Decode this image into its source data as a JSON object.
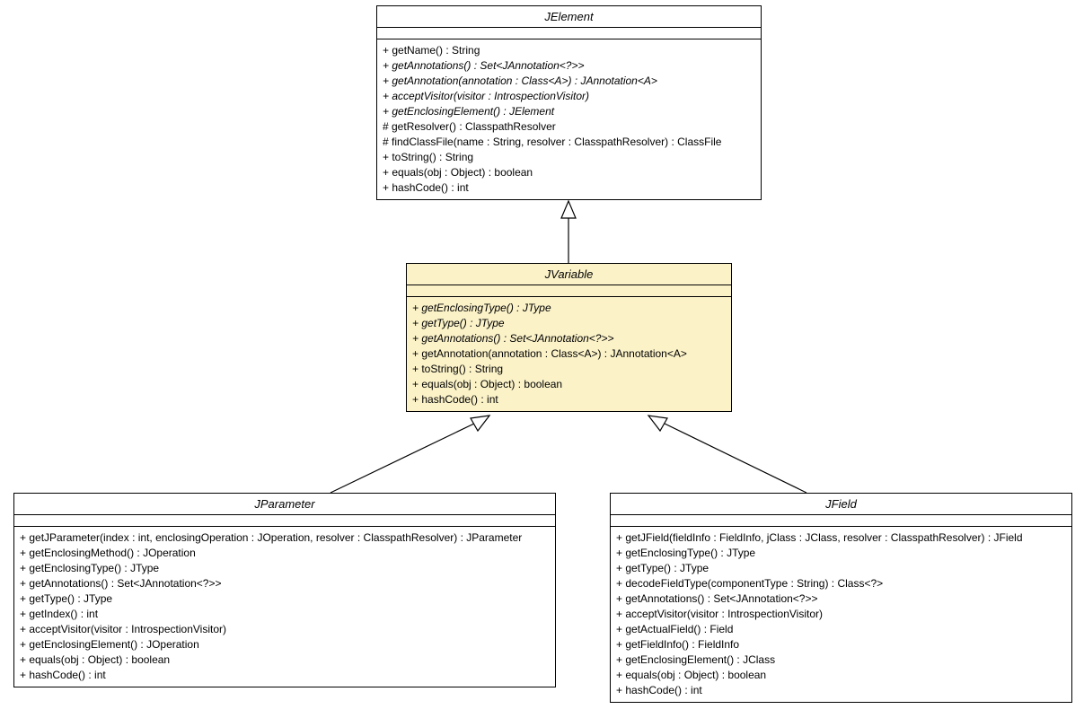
{
  "classes": {
    "jelement": {
      "name": "JElement",
      "methods": [
        {
          "text": "+ getName() : String",
          "italic": false
        },
        {
          "text": "+ getAnnotations() : Set<JAnnotation<?>>",
          "italic": true
        },
        {
          "text": "+ getAnnotation(annotation : Class<A>) : JAnnotation<A>",
          "italic": true
        },
        {
          "text": "+ acceptVisitor(visitor : IntrospectionVisitor)",
          "italic": true
        },
        {
          "text": "+ getEnclosingElement() : JElement",
          "italic": true
        },
        {
          "text": "# getResolver() : ClasspathResolver",
          "italic": false
        },
        {
          "text": "# findClassFile(name : String, resolver : ClasspathResolver) : ClassFile",
          "italic": false
        },
        {
          "text": "+ toString() : String",
          "italic": false
        },
        {
          "text": "+ equals(obj : Object) : boolean",
          "italic": false
        },
        {
          "text": "+ hashCode() : int",
          "italic": false
        }
      ]
    },
    "jvariable": {
      "name": "JVariable",
      "methods": [
        {
          "text": "+ getEnclosingType() : JType",
          "italic": true
        },
        {
          "text": "+ getType() : JType",
          "italic": true
        },
        {
          "text": "+ getAnnotations() : Set<JAnnotation<?>>",
          "italic": true
        },
        {
          "text": "+ getAnnotation(annotation : Class<A>) : JAnnotation<A>",
          "italic": false
        },
        {
          "text": "+ toString() : String",
          "italic": false
        },
        {
          "text": "+ equals(obj : Object) : boolean",
          "italic": false
        },
        {
          "text": "+ hashCode() : int",
          "italic": false
        }
      ]
    },
    "jparameter": {
      "name": "JParameter",
      "methods": [
        {
          "text": "+ getJParameter(index : int, enclosingOperation : JOperation, resolver : ClasspathResolver) : JParameter",
          "italic": false
        },
        {
          "text": "+ getEnclosingMethod() : JOperation",
          "italic": false
        },
        {
          "text": "+ getEnclosingType() : JType",
          "italic": false
        },
        {
          "text": "+ getAnnotations() : Set<JAnnotation<?>>",
          "italic": false
        },
        {
          "text": "+ getType() : JType",
          "italic": false
        },
        {
          "text": "+ getIndex() : int",
          "italic": false
        },
        {
          "text": "+ acceptVisitor(visitor : IntrospectionVisitor)",
          "italic": false
        },
        {
          "text": "+ getEnclosingElement() : JOperation",
          "italic": false
        },
        {
          "text": "+ equals(obj : Object) : boolean",
          "italic": false
        },
        {
          "text": "+ hashCode() : int",
          "italic": false
        }
      ]
    },
    "jfield": {
      "name": "JField",
      "methods": [
        {
          "text": "+ getJField(fieldInfo : FieldInfo, jClass : JClass, resolver : ClasspathResolver) : JField",
          "italic": false
        },
        {
          "text": "+ getEnclosingType() : JType",
          "italic": false
        },
        {
          "text": "+ getType() : JType",
          "italic": false
        },
        {
          "text": "+ decodeFieldType(componentType : String) : Class<?>",
          "italic": false
        },
        {
          "text": "+ getAnnotations() : Set<JAnnotation<?>>",
          "italic": false
        },
        {
          "text": "+ acceptVisitor(visitor : IntrospectionVisitor)",
          "italic": false
        },
        {
          "text": "+ getActualField() : Field",
          "italic": false
        },
        {
          "text": "+ getFieldInfo() : FieldInfo",
          "italic": false
        },
        {
          "text": "+ getEnclosingElement() : JClass",
          "italic": false
        },
        {
          "text": "+ equals(obj : Object) : boolean",
          "italic": false
        },
        {
          "text": "+ hashCode() : int",
          "italic": false
        }
      ]
    }
  }
}
